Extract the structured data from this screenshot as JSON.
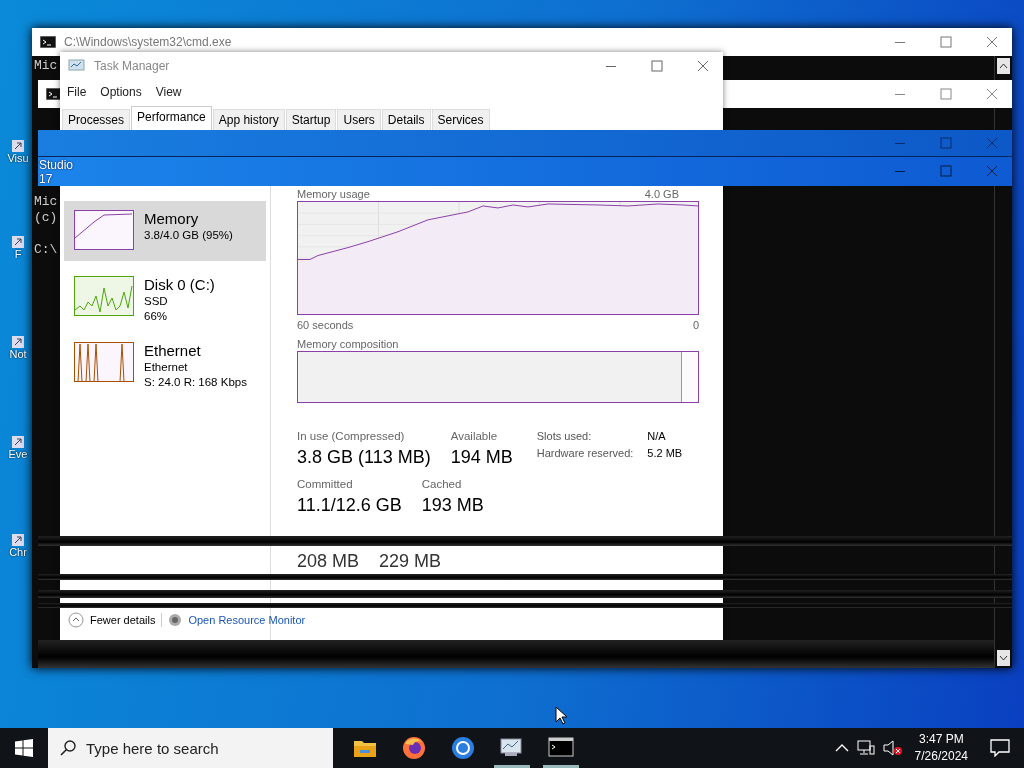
{
  "desktop_icons": [
    {
      "label": "Visu"
    },
    {
      "label": "F"
    },
    {
      "label": "Not"
    },
    {
      "label": "Eve"
    },
    {
      "label": "Chr"
    }
  ],
  "cmd_window": {
    "title": "C:\\Windows\\system32\\cmd.exe",
    "top_lines": [
      "Mic"
    ],
    "lines": [
      "Mic",
      "(c)",
      "C:\\"
    ]
  },
  "blue_bar": {
    "lines": [
      "Studio",
      "17"
    ]
  },
  "task_manager": {
    "title": "Task Manager",
    "menu": [
      "File",
      "Options",
      "View"
    ],
    "tabs": [
      {
        "label": "Processes",
        "selected": false
      },
      {
        "label": "Performance",
        "selected": true
      },
      {
        "label": "App history",
        "selected": false
      },
      {
        "label": "Startup",
        "selected": false
      },
      {
        "label": "Users",
        "selected": false
      },
      {
        "label": "Details",
        "selected": false
      },
      {
        "label": "Services",
        "selected": false
      }
    ],
    "sidebar": {
      "items": [
        {
          "name": "Memory",
          "lines": [
            "3.8/4.0 GB (95%)"
          ],
          "color": "#8b3fa8",
          "selected": true
        },
        {
          "name": "Disk 0 (C:)",
          "lines": [
            "SSD",
            "66%"
          ],
          "color": "#4da60c",
          "selected": false
        },
        {
          "name": "Ethernet",
          "lines": [
            "Ethernet",
            "S: 24.0 R: 168 Kbps"
          ],
          "color": "#a74f01",
          "selected": false
        }
      ]
    },
    "memory_usage": {
      "label": "Memory usage",
      "max": "4.0 GB",
      "time_span": "60 seconds",
      "end": "0"
    },
    "memory_composition": {
      "label": "Memory composition"
    },
    "stats": [
      {
        "label": "In use (Compressed)",
        "value": "3.8 GB (113 MB)"
      },
      {
        "label": "Available",
        "value": "194 MB"
      }
    ],
    "stats_row2": [
      {
        "label": "Committed",
        "value": "11.1/12.6 GB"
      },
      {
        "label": "Cached",
        "value": "193 MB"
      }
    ],
    "stats_row3": [
      {
        "value": "208 MB"
      },
      {
        "value": "229 MB"
      }
    ],
    "details": [
      {
        "label": "Slots used:",
        "value": "N/A"
      },
      {
        "label": "Hardware reserved:",
        "value": "5.2 MB"
      }
    ],
    "footer": {
      "fewer_details": "Fewer details",
      "resource_monitor": "Open Resource Monitor"
    }
  },
  "taskbar": {
    "search_placeholder": "Type here to search",
    "time": "3:47 PM",
    "date": "7/26/2024"
  }
}
